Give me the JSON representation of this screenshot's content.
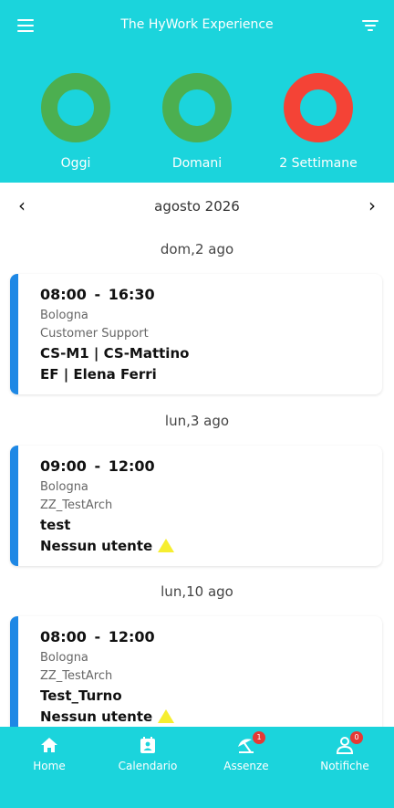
{
  "header": {
    "title": "The HyWork Experience",
    "menu_icon": "hamburger-menu-icon",
    "filter_icon": "filter-icon"
  },
  "summary": [
    {
      "label": "Oggi",
      "color": "#4caf50"
    },
    {
      "label": "Domani",
      "color": "#4caf50"
    },
    {
      "label": "2 Settimane",
      "color": "#f44336"
    }
  ],
  "calendar": {
    "month_label": "agosto 2026",
    "prev": "‹",
    "next": "›"
  },
  "days": [
    {
      "date_label": "dom,2 ago",
      "shift": {
        "time": "08:00 - 16:30",
        "location": "Bologna",
        "department": "Customer Support",
        "role": "CS-M1 | CS-Mattino",
        "assignee": "EF | Elena Ferri",
        "warning": false
      }
    },
    {
      "date_label": "lun,3 ago",
      "shift": {
        "time": "09:00 - 12:00",
        "location": "Bologna",
        "department": "ZZ_TestArch",
        "role": "test",
        "assignee": "Nessun utente",
        "warning": true
      }
    },
    {
      "date_label": "lun,10 ago",
      "shift": {
        "time": "08:00 - 12:00",
        "location": "Bologna",
        "department": "ZZ_TestArch",
        "role": "Test_Turno",
        "assignee": "Nessun utente",
        "warning": true
      }
    }
  ],
  "nav": [
    {
      "label": "Home",
      "icon": "home-icon",
      "badge": ""
    },
    {
      "label": "Calendario",
      "icon": "calendar-icon",
      "badge": ""
    },
    {
      "label": "Assenze",
      "icon": "beach-umbrella-icon",
      "badge": "1"
    },
    {
      "label": "Notifiche",
      "icon": "user-icon",
      "badge": "0"
    }
  ],
  "colors": {
    "accent": "#1bd4dc",
    "card_border": "#1e88e5",
    "ok": "#4caf50",
    "alert": "#f44336",
    "warning": "#f6ee30"
  }
}
